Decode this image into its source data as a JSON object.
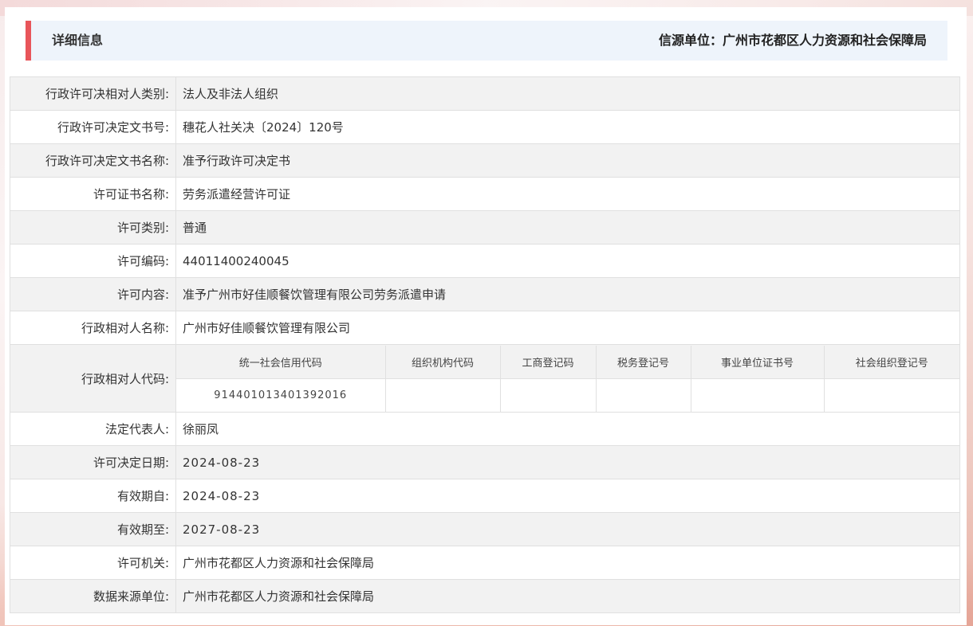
{
  "header": {
    "title": "详细信息",
    "source": "信源单位：广州市花都区人力资源和社会保障局"
  },
  "rows": {
    "r1": {
      "label": "行政许可决相对人类别:",
      "value": "法人及非法人组织"
    },
    "r2": {
      "label": "行政许可决定文书号:",
      "value": "穗花人社关决〔2024〕120号"
    },
    "r3": {
      "label": "行政许可决定文书名称:",
      "value": "准予行政许可决定书"
    },
    "r4": {
      "label": "许可证书名称:",
      "value": "劳务派遣经营许可证"
    },
    "r5": {
      "label": "许可类别:",
      "value": "普通"
    },
    "r6": {
      "label": "许可编码:",
      "value": "44011400240045"
    },
    "r7": {
      "label": "许可内容:",
      "value": "准予广州市好佳顺餐饮管理有限公司劳务派遣申请"
    },
    "r8": {
      "label": "行政相对人名称:",
      "value": "广州市好佳顺餐饮管理有限公司"
    },
    "r9": {
      "label": "行政相对人代码:",
      "headers": [
        "统一社会信用代码",
        "组织机构代码",
        "工商登记码",
        "税务登记号",
        "事业单位证书号",
        "社会组织登记号"
      ],
      "values": [
        "914401013401392016",
        "",
        "",
        "",
        "",
        ""
      ]
    },
    "r10": {
      "label": "法定代表人:",
      "value": "徐丽凤"
    },
    "r11": {
      "label": "许可决定日期:",
      "value": "2024-08-23"
    },
    "r12": {
      "label": "有效期自:",
      "value": "2024-08-23"
    },
    "r13": {
      "label": "有效期至:",
      "value": "2027-08-23"
    },
    "r14": {
      "label": "许可机关:",
      "value": "广州市花都区人力资源和社会保障局"
    },
    "r15": {
      "label": "数据来源单位:",
      "value": "广州市花都区人力资源和社会保障局"
    }
  }
}
